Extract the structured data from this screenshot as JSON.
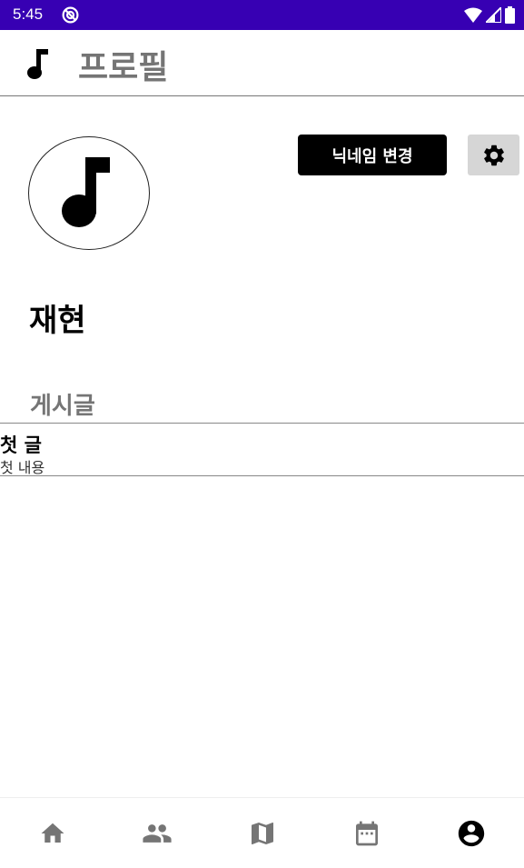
{
  "status_bar": {
    "time": "5:45",
    "background": "#3700b3"
  },
  "app_bar": {
    "title": "프로필",
    "icon": "music-note-icon"
  },
  "profile": {
    "avatar_icon": "music-note-icon",
    "nickname_button_label": "닉네임 변경",
    "settings_icon": "gear-icon",
    "username": "재현"
  },
  "posts": {
    "section_title": "게시글",
    "items": [
      {
        "title": "첫 글",
        "content": "첫 내용"
      }
    ]
  },
  "bottom_nav": {
    "items": [
      {
        "icon": "home-icon",
        "active": false
      },
      {
        "icon": "people-icon",
        "active": false
      },
      {
        "icon": "map-icon",
        "active": false
      },
      {
        "icon": "calendar-icon",
        "active": false
      },
      {
        "icon": "account-circle-icon",
        "active": true
      }
    ]
  }
}
